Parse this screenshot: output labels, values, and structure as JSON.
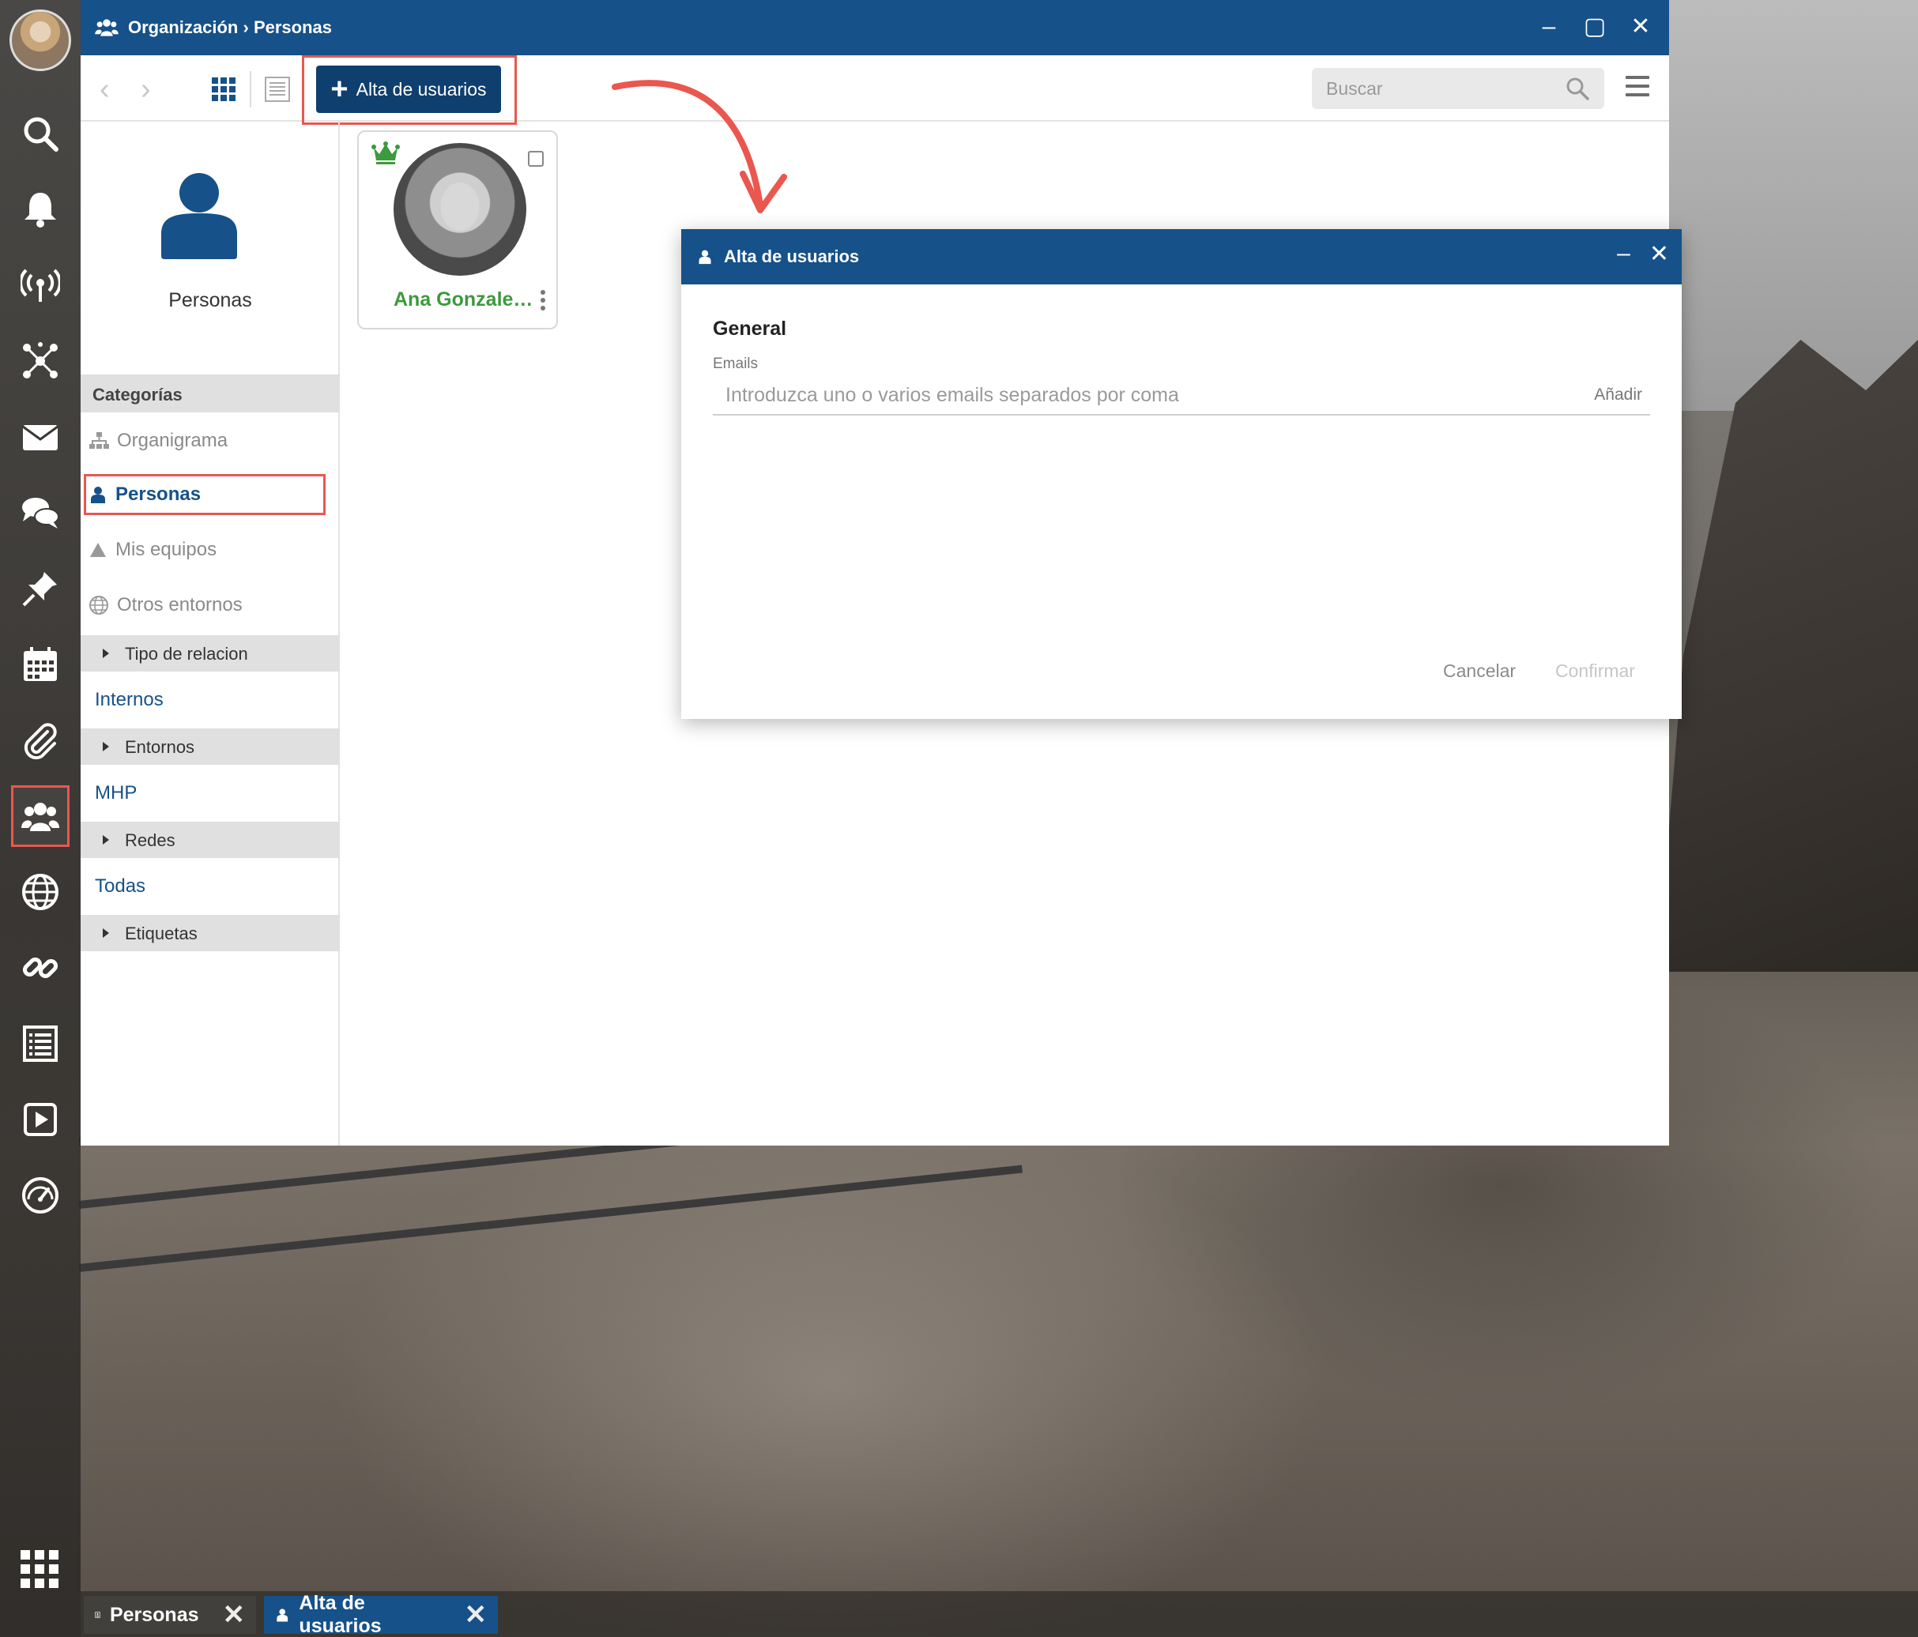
{
  "window": {
    "breadcrumb_section": "Organización",
    "breadcrumb_sep": "›",
    "breadcrumb_page": "Personas",
    "minimize": "–",
    "maximize": "▢",
    "close": "✕"
  },
  "toolbar": {
    "back": "‹",
    "forward": "›",
    "add_users_label": "Alta de usuarios",
    "search_placeholder": "Buscar"
  },
  "left_panel": {
    "title": "Personas",
    "categories_header": "Categorías",
    "items": [
      {
        "label": "Organigrama"
      },
      {
        "label": "Personas"
      },
      {
        "label": "Mis equipos"
      },
      {
        "label": "Otros entornos"
      }
    ],
    "groups": [
      {
        "header": "Tipo de relacion",
        "link": "Internos"
      },
      {
        "header": "Entornos",
        "link": "MHP"
      },
      {
        "header": "Redes",
        "link": "Todas"
      },
      {
        "header": "Etiquetas",
        "link": ""
      }
    ]
  },
  "people": [
    {
      "name": "Ana Gonzalez ..."
    }
  ],
  "dialog": {
    "title": "Alta de usuarios",
    "section": "General",
    "emails_label": "Emails",
    "emails_placeholder": "Introduzca uno o varios emails separados por coma",
    "add_label": "Añadir",
    "cancel_label": "Cancelar",
    "confirm_label": "Confirmar",
    "minimize": "–",
    "close": "✕"
  },
  "taskbar": {
    "tabs": [
      {
        "label": "Personas",
        "close": "✕"
      },
      {
        "label": "Alta de usuarios",
        "close": "✕"
      }
    ]
  },
  "colors": {
    "primary": "#165189",
    "highlight": "#e9574f",
    "person_name": "#3d9a3d"
  },
  "sidebar_icons": [
    "search-icon",
    "bell-icon",
    "broadcast-icon",
    "network-icon",
    "mail-icon",
    "chat-icon",
    "pin-icon",
    "calendar-icon",
    "paperclip-icon",
    "people-icon",
    "globe-icon",
    "link-icon",
    "list-icon",
    "play-icon",
    "gauge-icon",
    "apps-grid-icon"
  ]
}
